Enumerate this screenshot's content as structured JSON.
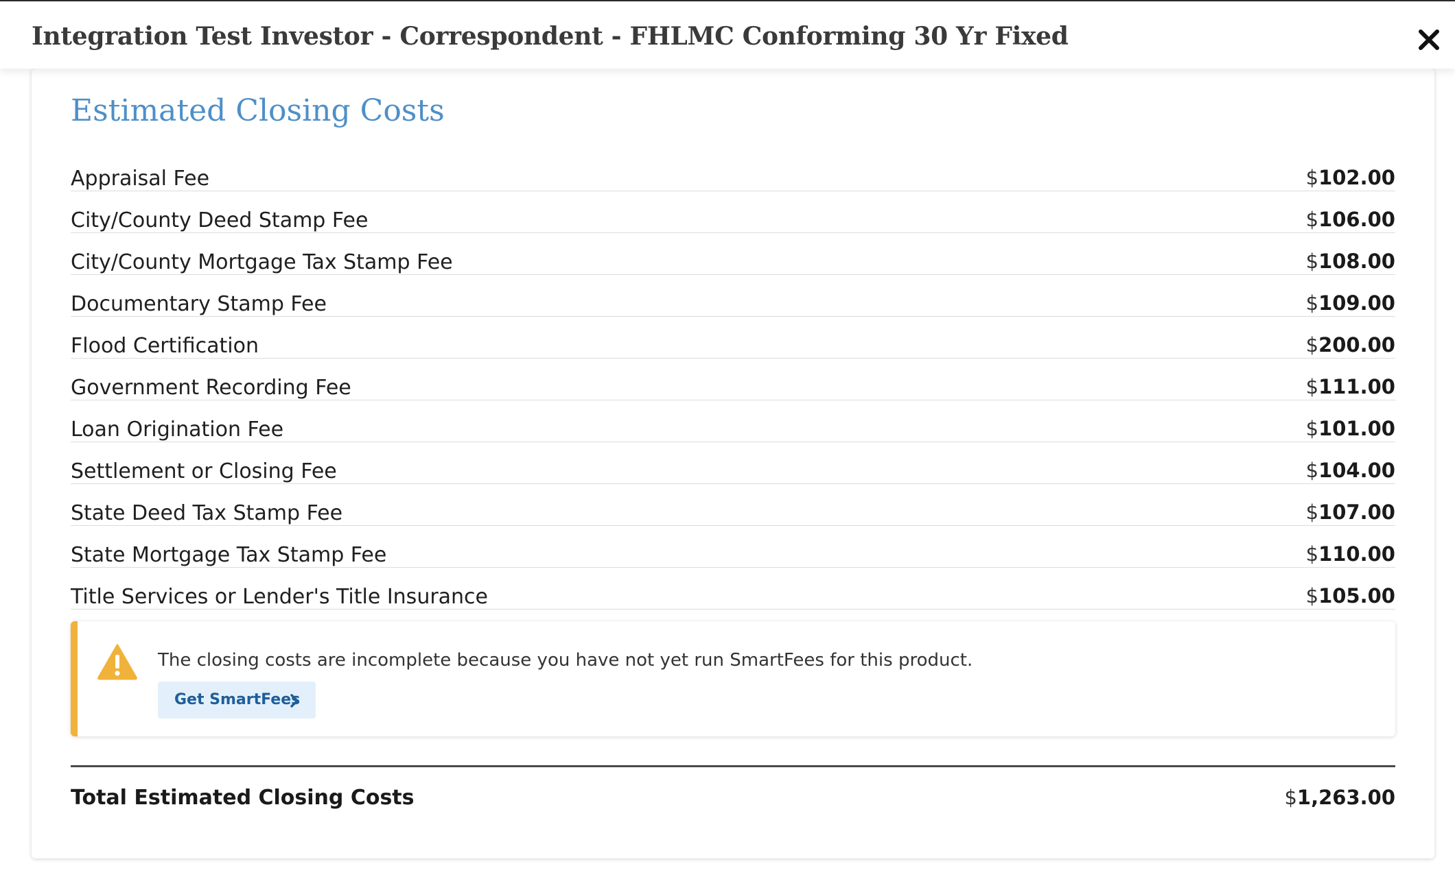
{
  "header": {
    "title": "Integration Test Investor - Correspondent - FHLMC Conforming 30 Yr Fixed",
    "close_icon": "close-icon"
  },
  "section": {
    "title": "Estimated Closing Costs"
  },
  "currency_symbol": "$",
  "fees": [
    {
      "label": "Appraisal Fee",
      "amount": "102.00"
    },
    {
      "label": "City/County Deed Stamp Fee",
      "amount": "106.00"
    },
    {
      "label": "City/County Mortgage Tax Stamp Fee",
      "amount": "108.00"
    },
    {
      "label": "Documentary Stamp Fee",
      "amount": "109.00"
    },
    {
      "label": "Flood Certification",
      "amount": "200.00"
    },
    {
      "label": "Government Recording Fee",
      "amount": "111.00"
    },
    {
      "label": "Loan Origination Fee",
      "amount": "101.00"
    },
    {
      "label": "Settlement or Closing Fee",
      "amount": "104.00"
    },
    {
      "label": "State Deed Tax Stamp Fee",
      "amount": "107.00"
    },
    {
      "label": "State Mortgage Tax Stamp Fee",
      "amount": "110.00"
    },
    {
      "label": "Title Services or Lender's Title Insurance",
      "amount": "105.00"
    }
  ],
  "alert": {
    "icon": "warning-icon",
    "message": "The closing costs are incomplete because you have not yet run SmartFees for this product.",
    "button_label": "Get SmartFees",
    "button_icon": "chevron-right-icon",
    "accent_color": "#f0b23a"
  },
  "total": {
    "label": "Total Estimated Closing Costs",
    "amount": "1,263.00"
  },
  "colors": {
    "section_title": "#4e8fc7",
    "button_bg": "#e3f0fb",
    "button_text": "#1f5e99"
  }
}
